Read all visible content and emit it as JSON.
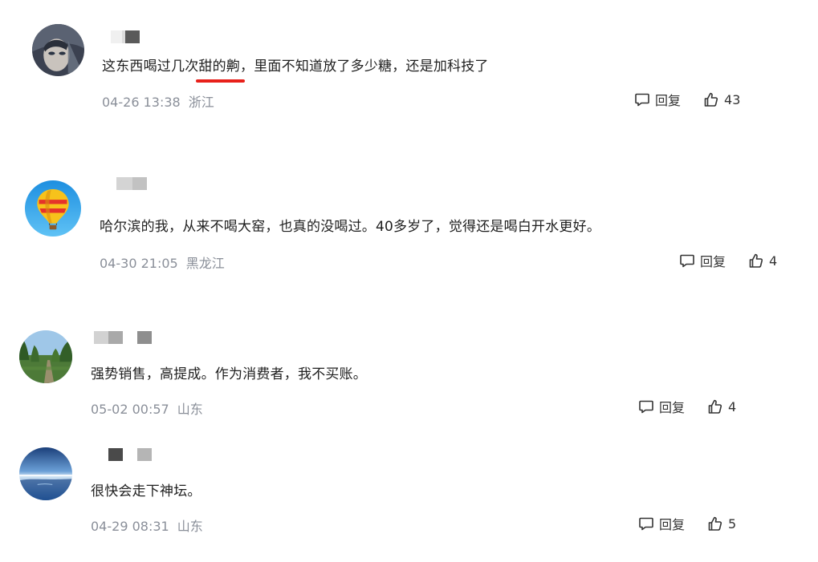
{
  "comments": [
    {
      "text_before": "这东西喝过几次",
      "text_highlight": "甜的齁",
      "text_after": "，里面不知道放了多少糖，还是加科技了",
      "date": "04-26 13:38",
      "location": "浙江",
      "reply_label": "回复",
      "likes": "43",
      "avatar_icon": "masked-face-avatar",
      "highlight_color": "#e8201a"
    },
    {
      "text": "哈尔滨的我，从来不喝大窑，也真的没喝过。40多岁了，觉得还是喝白开水更好。",
      "date": "04-30 21:05",
      "location": "黑龙江",
      "reply_label": "回复",
      "likes": "4",
      "avatar_icon": "hot-air-balloon-avatar"
    },
    {
      "text": "强势销售，高提成。作为消费者，我不买账。",
      "date": "05-02 00:57",
      "location": "山东",
      "reply_label": "回复",
      "likes": "4",
      "avatar_icon": "forest-path-avatar"
    },
    {
      "text": "很快会走下神坛。",
      "date": "04-29 08:31",
      "location": "山东",
      "reply_label": "回复",
      "likes": "5",
      "avatar_icon": "lake-sunset-avatar"
    }
  ],
  "colors": {
    "meta_text": "#8a8f99",
    "body_text": "#1f1f1f"
  }
}
